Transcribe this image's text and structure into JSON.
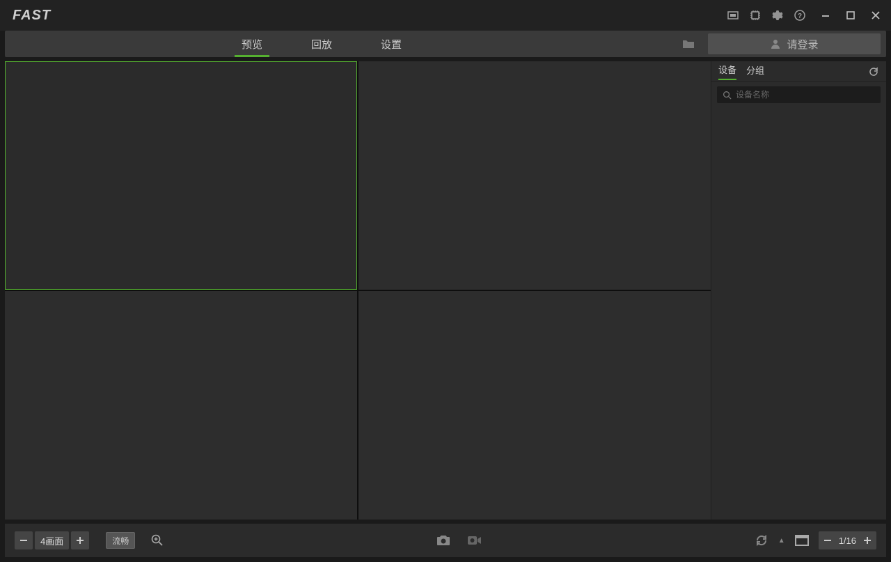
{
  "titlebar": {
    "logo": "FAST"
  },
  "tabs": {
    "preview": "预览",
    "playback": "回放",
    "settings": "设置"
  },
  "login": {
    "label": "请登录"
  },
  "sidebar": {
    "tab_devices": "设备",
    "tab_groups": "分组",
    "search_placeholder": "设备名称"
  },
  "bottombar": {
    "layout_label": "4画面",
    "quality_label": "流畅",
    "page_indicator": "1/16"
  }
}
